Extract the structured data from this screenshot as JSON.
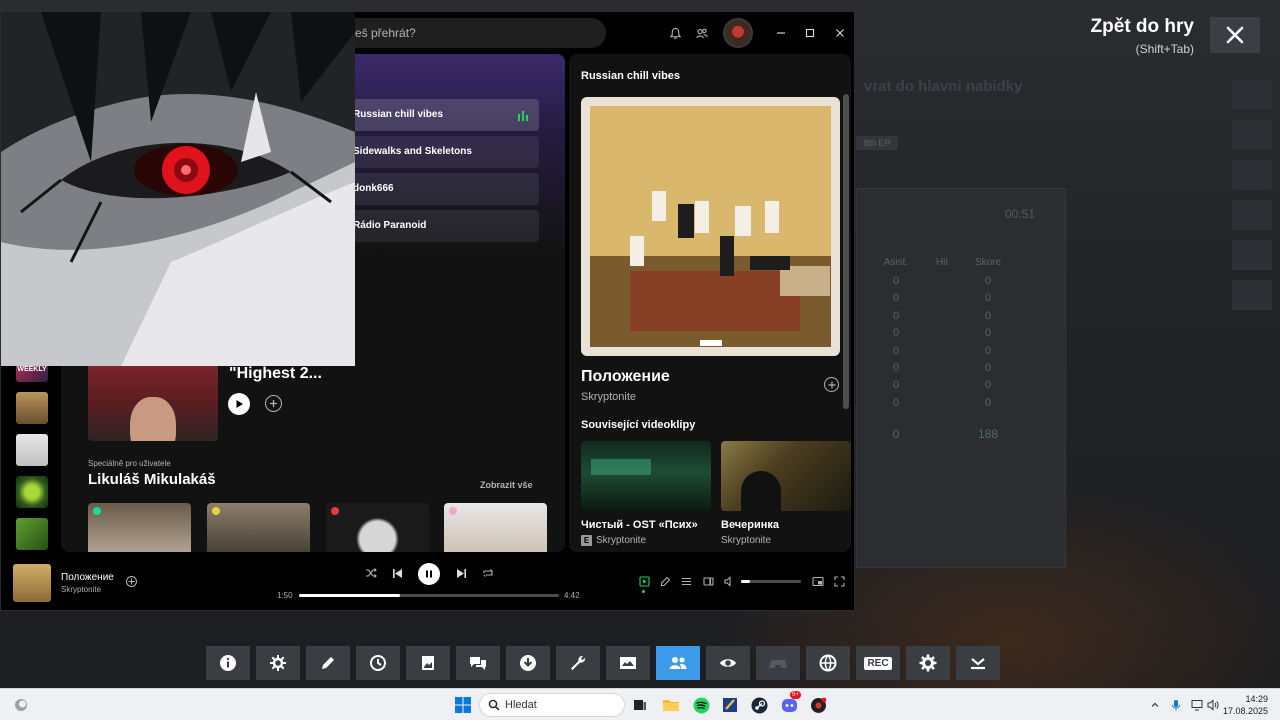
{
  "overlay": {
    "back_title": "Zpět do hry",
    "back_shortcut": "(Shift+Tab)"
  },
  "game": {
    "menu_text": "vrat do hlavni nabidky",
    "tag": "8th EP",
    "timer": "00:51",
    "headers": [
      "Asist.",
      "Hit",
      "Skore"
    ],
    "rows": [
      [
        "0",
        "0"
      ],
      [
        "0",
        "0"
      ],
      [
        "0",
        "0"
      ],
      [
        "0",
        "0"
      ],
      [
        "0",
        "0"
      ],
      [
        "0",
        "0"
      ],
      [
        "0",
        "0"
      ],
      [
        "0",
        "0"
      ]
    ],
    "totals": [
      "0",
      "188"
    ]
  },
  "spotify": {
    "search_placeholder": "eš přehrát?",
    "playlists": [
      {
        "label": "Russian chill vibes",
        "active": true
      },
      {
        "label": "Sidewalks and Skeletons",
        "active": false
      },
      {
        "label": "donk666",
        "active": false
      },
      {
        "label": "Rádio Paranoid",
        "active": false
      }
    ],
    "hero": {
      "title": "Tracks (From \"Highest 2..."
    },
    "section": {
      "kicker": "Speciálně pro uživatele",
      "title": "Likuláš Mikulakáš",
      "show_all": "Zobrazit vše"
    },
    "right_panel": {
      "playlist_title": "Russian chill vibes",
      "song": "Положение",
      "artist": "Skryptonite",
      "related_title": "Související videoklipy",
      "videos": [
        {
          "title": "Чистый - OST «Псих»",
          "artist": "Skryptonite",
          "explicit": "E"
        },
        {
          "title": "Вечеринка",
          "artist": "Skryptonite",
          "explicit": ""
        }
      ]
    },
    "player": {
      "title": "Положение",
      "artist": "Skryptonite",
      "elapsed": "1:50",
      "duration": "4:42",
      "progress_fraction": 0.39,
      "volume_fraction": 0.15
    }
  },
  "taskbar": {
    "search_placeholder": "Hledat",
    "time": "14:29",
    "date": "17.08.2025",
    "discord_badge": "9+"
  },
  "colors": {
    "spotify_green": "#1ed760",
    "toolbar_active": "#3d9ae8"
  }
}
